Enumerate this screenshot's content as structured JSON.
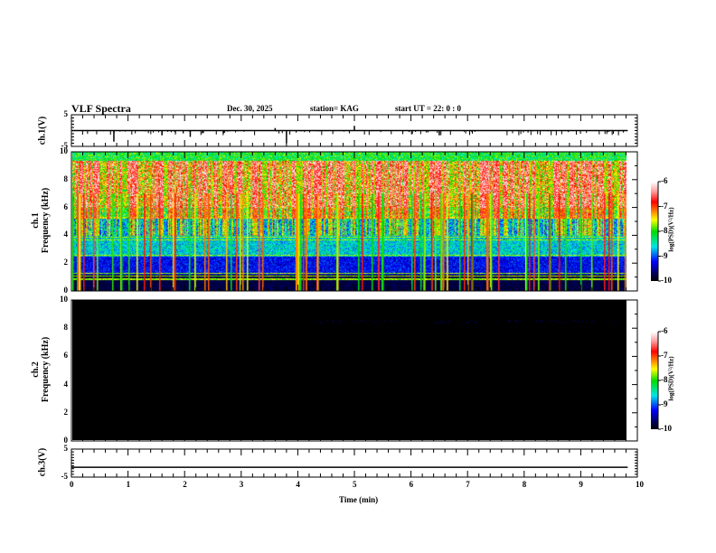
{
  "header": {
    "title": "VLF Spectra",
    "date": "Dec. 30, 2025",
    "station": "station= KAG",
    "start": "start  UT =   22: 0  : 0"
  },
  "chart_data": [
    {
      "type": "line",
      "ylabel": "ch.1(V)",
      "ylim": [
        -5,
        5
      ],
      "yticks": [
        "5",
        "-5"
      ],
      "xlim": [
        0,
        10
      ],
      "description_values": {
        "baseline": 0,
        "spike_times_min": [
          0.75,
          3.8,
          1.6,
          2.1,
          3.6,
          5.0
        ]
      }
    },
    {
      "type": "heatmap",
      "ylabel": "ch.1\nFrequency (kHz)",
      "ylim": [
        0,
        10
      ],
      "yticks": [
        "0",
        "2",
        "4",
        "6",
        "8",
        "10"
      ],
      "xlim": [
        0,
        10
      ],
      "data_end_min": 9.83,
      "colorbar": {
        "label": "log(PSD)(V²/Hz)",
        "range": [
          -10,
          -6
        ],
        "ticks": [
          "-6",
          "-7",
          "-8",
          "-9",
          "-10"
        ]
      }
    },
    {
      "type": "heatmap",
      "ylabel": "ch.2\nFrequency (kHz)",
      "ylim": [
        0,
        10
      ],
      "yticks": [
        "0",
        "2",
        "4",
        "6",
        "8",
        "10"
      ],
      "xlim": [
        0,
        10
      ],
      "data_end_min": 9.83,
      "colorbar": {
        "label": "log(PSD)(V²/Hz)",
        "range": [
          -10,
          -6
        ],
        "ticks": [
          "-6",
          "-7",
          "-8",
          "-9",
          "-10"
        ]
      }
    },
    {
      "type": "line",
      "ylabel": "ch.3(V)",
      "ylim": [
        -5,
        5
      ],
      "yticks": [
        "5",
        "-5"
      ],
      "xlim": [
        0,
        10
      ],
      "xlabel": "Time  (min)",
      "xticks": [
        "0",
        "1",
        "2",
        "3",
        "4",
        "5",
        "6",
        "7",
        "8",
        "9",
        "10"
      ],
      "description_values": {
        "baseline": -1.5
      }
    }
  ]
}
